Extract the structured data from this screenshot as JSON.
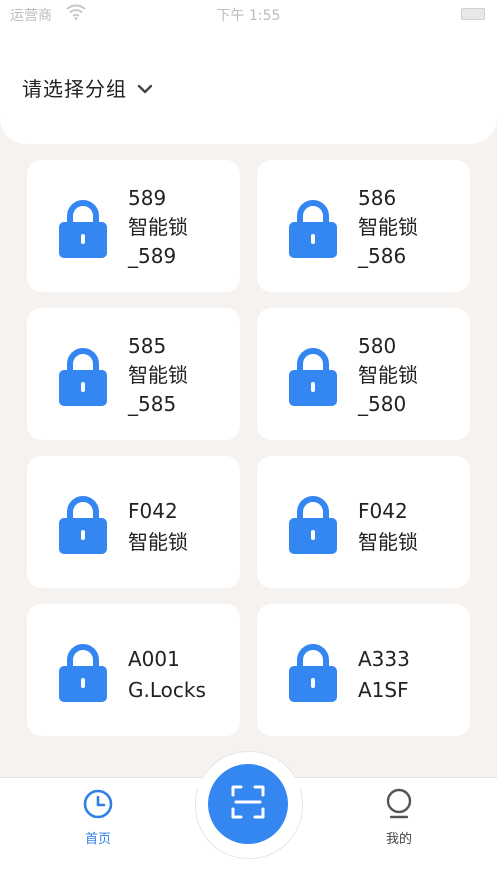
{
  "status_bar": {
    "carrier": "运营商",
    "time": "下午 1:55"
  },
  "header": {
    "group_selector_label": "请选择分组"
  },
  "devices": [
    {
      "lines": [
        "589",
        "智能锁",
        "_589"
      ]
    },
    {
      "lines": [
        "586",
        "智能锁",
        "_586"
      ]
    },
    {
      "lines": [
        "585",
        "智能锁",
        "_585"
      ]
    },
    {
      "lines": [
        "580",
        "智能锁",
        "_580"
      ]
    },
    {
      "lines": [
        "F042",
        "智能锁"
      ]
    },
    {
      "lines": [
        "F042",
        "智能锁"
      ]
    },
    {
      "lines": [
        "A001",
        "G.Locks"
      ]
    },
    {
      "lines": [
        "A333",
        "A1SF"
      ]
    }
  ],
  "tab_bar": {
    "home_label": "首页",
    "mine_label": "我的",
    "active_tab": "home"
  },
  "icons": {
    "lock": "lock-icon",
    "chevron": "chevron-down-icon",
    "home": "clock-icon",
    "mine": "user-icon",
    "scan": "scan-icon"
  },
  "colors": {
    "accent": "#3486f0",
    "tab_active": "#2f7fe6",
    "background": "#f5f2f0",
    "card": "#ffffff"
  }
}
